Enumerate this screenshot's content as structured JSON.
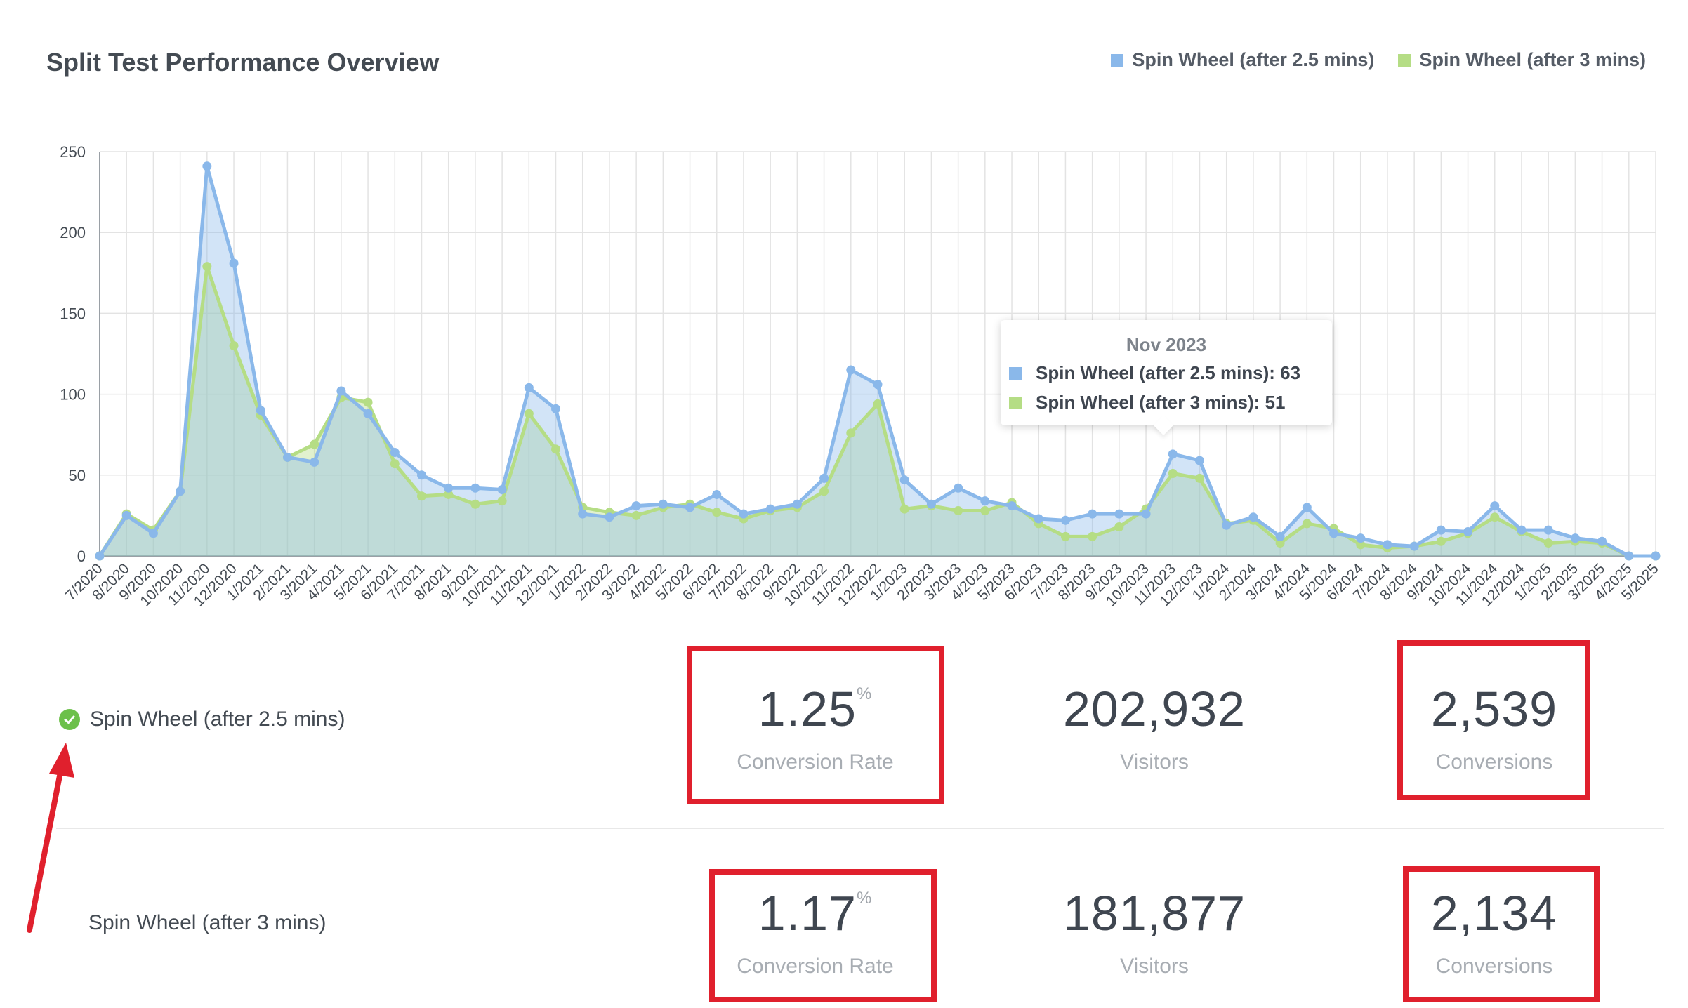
{
  "header": {
    "title": "Split Test Performance Overview"
  },
  "colors": {
    "series_a": "#8ab8ea",
    "series_b": "#b5dd85",
    "highlight": "#e0202d",
    "check": "#6cc04a"
  },
  "chart_data": {
    "type": "area",
    "x": [
      "7/2020",
      "8/2020",
      "9/2020",
      "10/2020",
      "11/2020",
      "12/2020",
      "1/2021",
      "2/2021",
      "3/2021",
      "4/2021",
      "5/2021",
      "6/2021",
      "7/2021",
      "8/2021",
      "9/2021",
      "10/2021",
      "11/2021",
      "12/2021",
      "1/2022",
      "2/2022",
      "3/2022",
      "4/2022",
      "5/2022",
      "6/2022",
      "7/2022",
      "8/2022",
      "9/2022",
      "10/2022",
      "11/2022",
      "12/2022",
      "1/2023",
      "2/2023",
      "3/2023",
      "4/2023",
      "5/2023",
      "6/2023",
      "7/2023",
      "8/2023",
      "9/2023",
      "10/2023",
      "11/2023",
      "12/2023",
      "1/2024",
      "2/2024",
      "3/2024",
      "4/2024",
      "5/2024",
      "6/2024",
      "7/2024",
      "8/2024",
      "9/2024",
      "10/2024",
      "11/2024",
      "12/2024",
      "1/2025",
      "2/2025",
      "3/2025",
      "4/2025",
      "5/2025"
    ],
    "series": [
      {
        "name": "Spin Wheel (after 2.5 mins)",
        "values": [
          0,
          25,
          14,
          40,
          241,
          181,
          90,
          61,
          58,
          102,
          88,
          64,
          50,
          42,
          42,
          41,
          104,
          91,
          26,
          24,
          31,
          32,
          30,
          38,
          26,
          29,
          32,
          48,
          115,
          106,
          47,
          32,
          42,
          34,
          31,
          23,
          22,
          26,
          26,
          26,
          63,
          59,
          19,
          24,
          12,
          30,
          14,
          11,
          7,
          6,
          16,
          15,
          31,
          16,
          16,
          11,
          9,
          0,
          0
        ]
      },
      {
        "name": "Spin Wheel (after 3 mins)",
        "values": [
          0,
          26,
          16,
          40,
          179,
          130,
          87,
          61,
          69,
          98,
          95,
          57,
          37,
          38,
          32,
          34,
          88,
          66,
          30,
          27,
          25,
          30,
          32,
          27,
          23,
          28,
          30,
          40,
          76,
          94,
          29,
          31,
          28,
          28,
          33,
          20,
          12,
          12,
          18,
          29,
          51,
          48,
          20,
          22,
          8,
          20,
          17,
          7,
          5,
          6,
          9,
          14,
          24,
          15,
          8,
          9,
          8,
          0,
          0
        ]
      }
    ],
    "ylim": [
      0,
      250
    ],
    "yticks": [
      0,
      50,
      100,
      150,
      200,
      250
    ],
    "grid": true,
    "legend": "top-right"
  },
  "tooltip": {
    "title": "Nov 2023",
    "rows": [
      {
        "label": "Spin Wheel (after 2.5 mins): 63"
      },
      {
        "label": "Spin Wheel (after 3 mins): 51"
      }
    ]
  },
  "variants": [
    {
      "name": "Spin Wheel (after 2.5 mins)",
      "conversion_rate": "1.25",
      "rate_unit": "%",
      "rate_label": "Conversion Rate",
      "visitors": "202,932",
      "visitors_label": "Visitors",
      "conversions": "2,539",
      "conversions_label": "Conversions"
    },
    {
      "name": "Spin Wheel (after 3 mins)",
      "conversion_rate": "1.17",
      "rate_unit": "%",
      "rate_label": "Conversion Rate",
      "visitors": "181,877",
      "visitors_label": "Visitors",
      "conversions": "2,134",
      "conversions_label": "Conversions"
    }
  ]
}
